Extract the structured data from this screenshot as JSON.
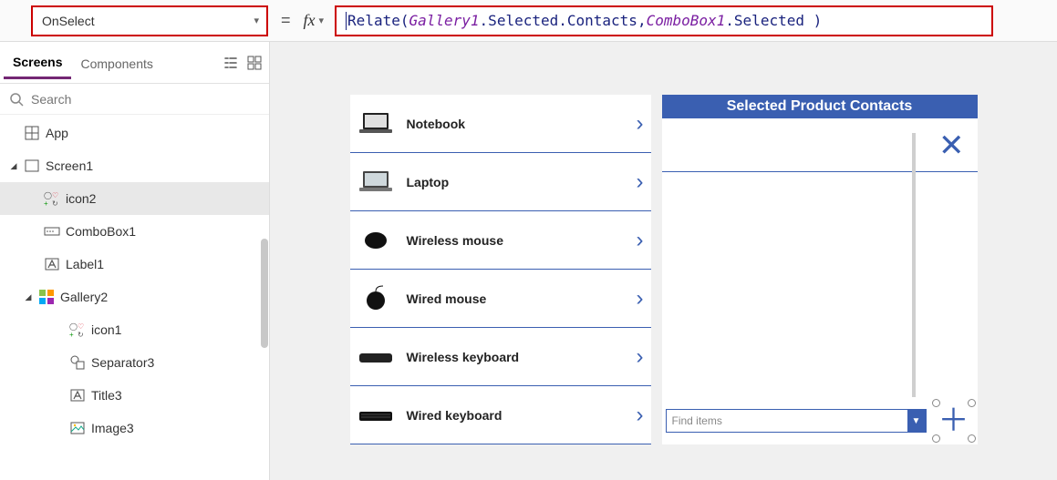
{
  "formula_bar": {
    "property": "OnSelect",
    "equals": "=",
    "fx": "fx",
    "tokens": {
      "fn": "Relate",
      "open": "( ",
      "obj1": "Gallery1",
      "dot1": ".Selected.Contacts",
      "comma": ", ",
      "obj2": "ComboBox1",
      "dot2": ".Selected )"
    }
  },
  "left": {
    "tabs": {
      "screens": "Screens",
      "components": "Components"
    },
    "search_placeholder": "Search",
    "items": {
      "app": "App",
      "screen1": "Screen1",
      "icon2": "icon2",
      "combobox1": "ComboBox1",
      "label1": "Label1",
      "gallery2": "Gallery2",
      "icon1": "icon1",
      "separator3": "Separator3",
      "title3": "Title3",
      "image3": "Image3"
    }
  },
  "canvas": {
    "products": [
      {
        "name": "Notebook"
      },
      {
        "name": "Laptop"
      },
      {
        "name": "Wireless mouse"
      },
      {
        "name": "Wired mouse"
      },
      {
        "name": "Wireless keyboard"
      },
      {
        "name": "Wired keyboard"
      }
    ],
    "right": {
      "header": "Selected Product Contacts",
      "combo_placeholder": "Find items"
    }
  }
}
